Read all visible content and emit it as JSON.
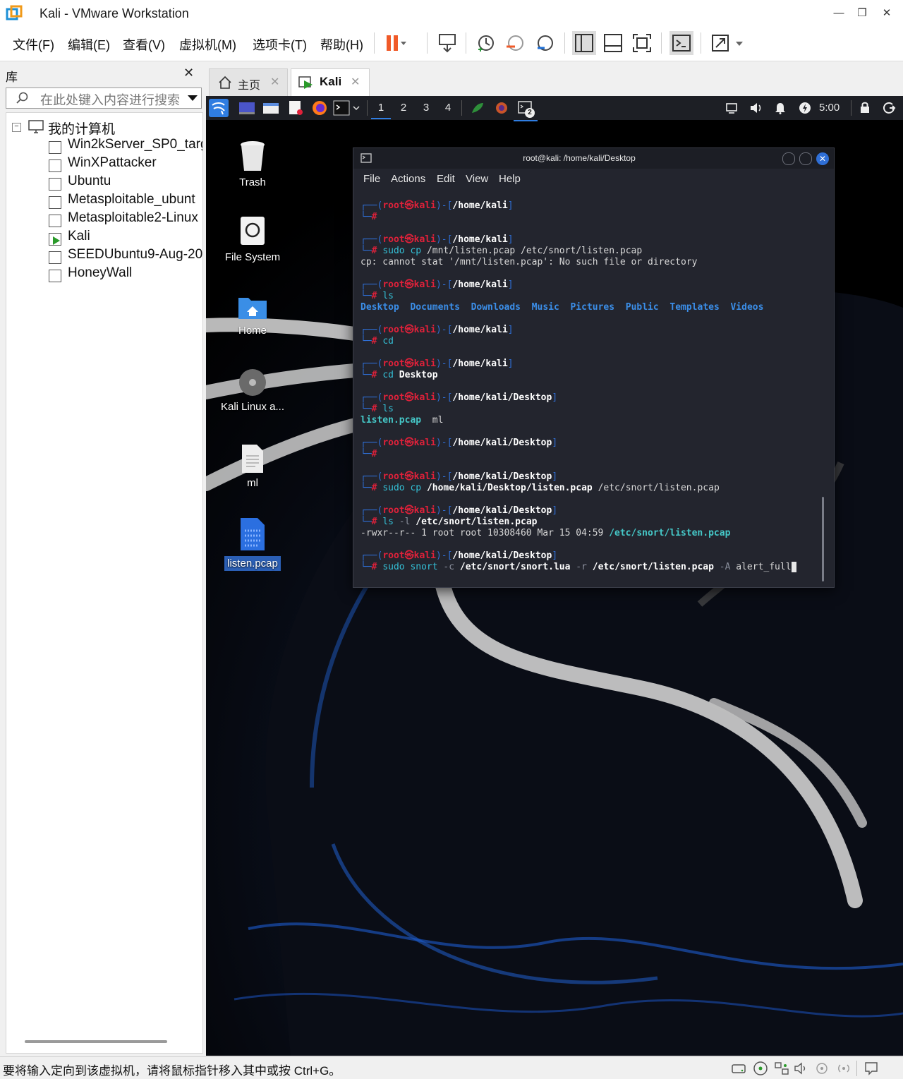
{
  "window": {
    "title": "Kali - VMware Workstation",
    "controls": [
      "—",
      "❐",
      "✕"
    ]
  },
  "menu": [
    "文件(F)",
    "编辑(E)",
    "查看(V)",
    "虚拟机(M)",
    "选项卡(T)",
    "帮助(H)"
  ],
  "library": {
    "title": "库",
    "close": "✕",
    "search_placeholder": "在此处键入内容进行搜索",
    "root": "我的计算机",
    "items": [
      "Win2kServer_SP0_targ",
      "WinXPattacker",
      "Ubuntu",
      "Metasploitable_ubunt",
      "Metasploitable2-Linux",
      "Kali",
      "SEEDUbuntu9-Aug-20",
      "HoneyWall"
    ],
    "selected": "Kali"
  },
  "tabs": [
    {
      "label": "主页",
      "close": "✕"
    },
    {
      "label": "Kali",
      "close": "✕"
    }
  ],
  "kali_panel": {
    "workspaces": [
      "1",
      "2",
      "3",
      "4"
    ],
    "clock": "5:00",
    "terminal_badge": "2"
  },
  "desktop_icons": [
    "Trash",
    "File System",
    "Home",
    "Kali Linux a...",
    "ml",
    "listen.pcap"
  ],
  "terminal": {
    "title": "root@kali: /home/kali/Desktop",
    "menu": [
      "File",
      "Actions",
      "Edit",
      "View",
      "Help"
    ],
    "prompt_user": "root",
    "prompt_sym": "㉿",
    "prompt_host": "kali",
    "blocks": [
      {
        "dir": "/home/kali",
        "cmd": "",
        "args": "",
        "output": []
      },
      {
        "dir": "/home/kali",
        "cmd": "sudo cp",
        "args": "/mnt/listen.pcap /etc/snort/listen.pcap",
        "output": [
          "cp: cannot stat '/mnt/listen.pcap': No such file or directory"
        ]
      },
      {
        "dir": "/home/kali",
        "cmd": "ls",
        "args": "",
        "dirs_output": [
          "Desktop",
          "Documents",
          "Downloads",
          "Music",
          "Pictures",
          "Public",
          "Templates",
          "Videos"
        ]
      },
      {
        "dir": "/home/kali",
        "cmd": "cd",
        "args": "",
        "output": []
      },
      {
        "dir": "/home/kali",
        "cmd": "cd",
        "args": "Desktop",
        "output": []
      },
      {
        "dir": "/home/kali/Desktop",
        "cmd": "ls",
        "args": "",
        "files_output": [
          "listen.pcap",
          "ml"
        ]
      },
      {
        "dir": "/home/kali/Desktop",
        "cmd": "",
        "args": "",
        "output": []
      },
      {
        "dir": "/home/kali/Desktop",
        "cmd": "sudo cp",
        "args": "/home/kali/Desktop/listen.pcap /etc/snort/listen.pcap",
        "output": []
      },
      {
        "dir": "/home/kali/Desktop",
        "cmd": "ls -l",
        "args": "/etc/snort/listen.pcap",
        "long_output": {
          "meta": "-rwxr--r-- 1 root root 10308460 Mar 15 04:59 ",
          "file": "/etc/snort/listen.pcap"
        }
      },
      {
        "dir": "/home/kali/Desktop",
        "cmd": "sudo snort -c",
        "args": "/etc/snort/snort.lua -r /etc/snort/listen.pcap -A alert_full",
        "output": []
      }
    ]
  },
  "status_bar": {
    "message": "要将输入定向到该虚拟机，请将鼠标指针移入其中或按 Ctrl+G。"
  },
  "colors": {
    "accent": "#2f6fd6",
    "prompt_red": "#e0213a",
    "terminal_bg": "#23252e",
    "panel_bg": "#1d1f25",
    "pause_orange": "#f05a28"
  }
}
